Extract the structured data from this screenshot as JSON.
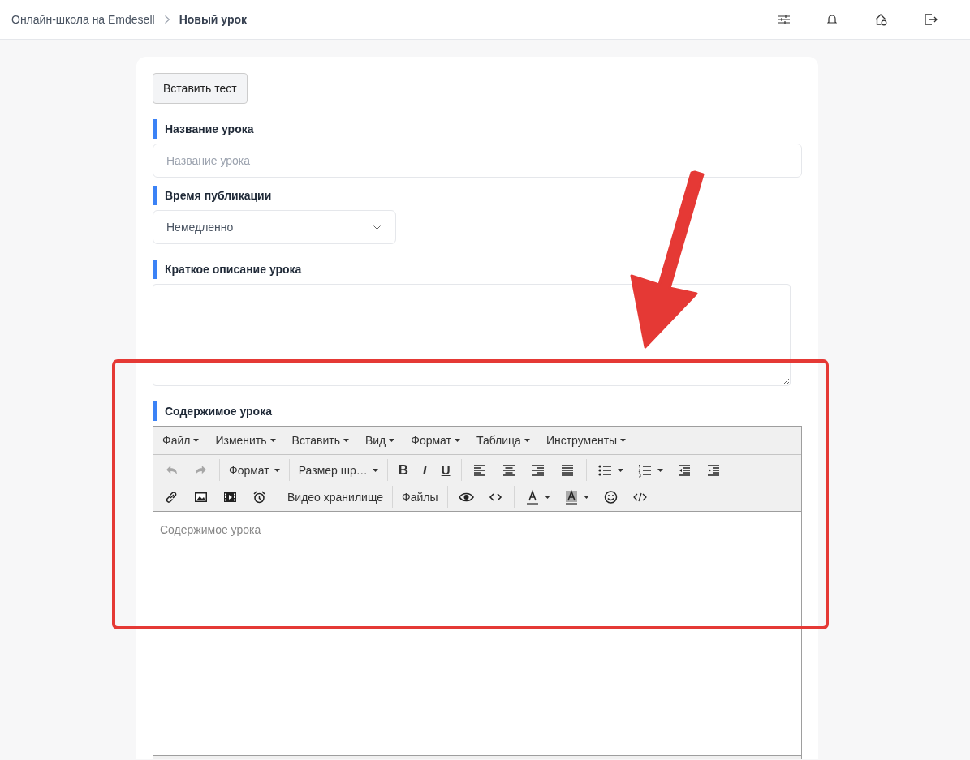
{
  "breadcrumbs": [
    {
      "label": "Онлайн-школа на Emdesell",
      "current": false
    },
    {
      "label": "Новый урок",
      "current": true
    }
  ],
  "header_actions": [
    {
      "kind": "sliders"
    },
    {
      "kind": "bell"
    },
    {
      "kind": "home"
    },
    {
      "kind": "logout"
    }
  ],
  "insert_test_button": "Вставить тест",
  "fields": [
    {
      "kind": "input",
      "label": "Название урока",
      "placeholder": "Название урока"
    },
    {
      "kind": "select",
      "label": "Время публикации",
      "value": "Немедленно"
    },
    {
      "kind": "textarea",
      "label": "Краткое описание урока"
    }
  ],
  "editor": {
    "label": "Содержимое урока",
    "menu": [
      "Файл",
      "Изменить",
      "Вставить",
      "Вид",
      "Формат",
      "Таблица",
      "Инструменты"
    ],
    "toolbar_rows": [
      [
        [
          {
            "kind": "undo",
            "disabled": true
          },
          {
            "kind": "redo",
            "disabled": true
          }
        ],
        [
          {
            "kind": "dropdown",
            "label": "Формат"
          }
        ],
        [
          {
            "kind": "dropdown",
            "label": "Размер шр…"
          }
        ],
        [
          {
            "kind": "bold",
            "label": "B"
          },
          {
            "kind": "italic",
            "label": "I"
          },
          {
            "kind": "underline",
            "label": "U"
          }
        ],
        [
          {
            "kind": "align-left"
          },
          {
            "kind": "align-center"
          },
          {
            "kind": "align-right"
          },
          {
            "kind": "justify"
          }
        ],
        [
          {
            "kind": "bullets"
          },
          {
            "kind": "numbers"
          },
          {
            "kind": "outdent"
          },
          {
            "kind": "indent"
          }
        ]
      ],
      [
        [
          {
            "kind": "link"
          },
          {
            "kind": "image"
          },
          {
            "kind": "media"
          },
          {
            "kind": "alarm"
          }
        ],
        [
          {
            "kind": "text",
            "label": "Видео хранилище"
          }
        ],
        [
          {
            "kind": "text",
            "label": "Файлы"
          }
        ],
        [
          {
            "kind": "eye"
          },
          {
            "kind": "code"
          }
        ],
        [
          {
            "kind": "text-color"
          },
          {
            "kind": "bg-color"
          },
          {
            "kind": "emoji"
          },
          {
            "kind": "source"
          }
        ]
      ]
    ],
    "placeholder": "Содержимое урока"
  }
}
